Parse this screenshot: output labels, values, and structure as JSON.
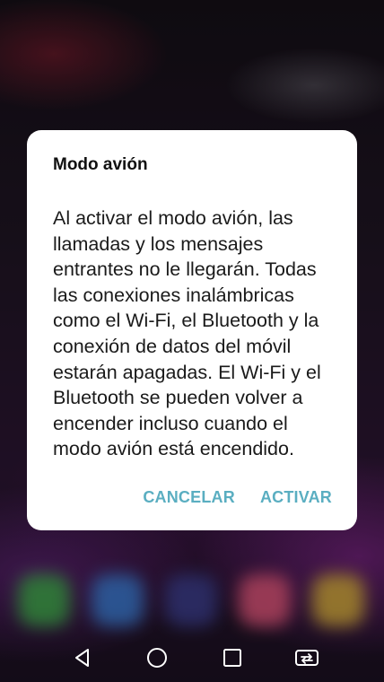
{
  "dialog": {
    "title": "Modo avión",
    "message": "Al activar el modo avión, las llamadas y los mensajes entrantes no le llegarán. Todas las conexiones inalámbricas como el Wi-Fi, el Bluetooth y la conexión de datos del móvil estarán apagadas. El Wi-Fi y el Bluetooth se pueden volver a encender incluso cuando el modo avión está encendido.",
    "cancel_label": "CANCELAR",
    "confirm_label": "ACTIVAR"
  },
  "colors": {
    "accent": "#5aaec1",
    "dialog_background": "#ffffff"
  },
  "navbar": {
    "buttons": [
      "back-icon",
      "home-icon",
      "recents-icon",
      "screen-switch-icon"
    ]
  }
}
